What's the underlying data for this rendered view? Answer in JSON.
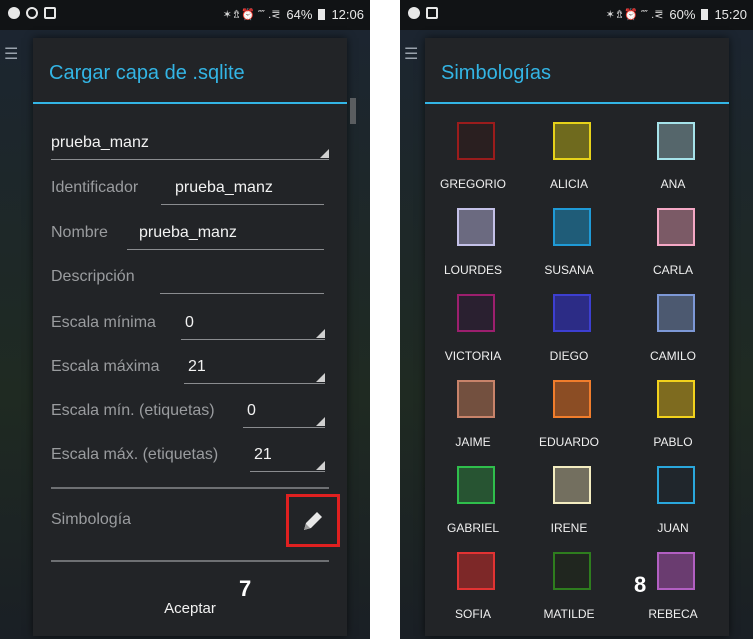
{
  "left_screen": {
    "status_bar": {
      "notification_icons": [
        "info-icon",
        "whatsapp-icon",
        "image-icon"
      ],
      "signal_text": "✶⇯⏰ ⁗ .⪙",
      "battery": "64%",
      "time": "12:06"
    },
    "dialog": {
      "title": "Cargar capa de .sqlite",
      "layer_select": "prueba_manz",
      "fields": [
        {
          "label": "Identificador",
          "value": "prueba_manz"
        },
        {
          "label": "Nombre",
          "value": "prueba_manz"
        },
        {
          "label": "Descripción",
          "value": ""
        }
      ],
      "scale_fields": [
        {
          "label": "Escala mínima",
          "value": "0"
        },
        {
          "label": "Escala máxima",
          "value": "21"
        },
        {
          "label": "Escala mín. (etiquetas)",
          "value": "0"
        },
        {
          "label": "Escala máx. (etiquetas)",
          "value": "21"
        }
      ],
      "symbology_label": "Simbología",
      "edit_icon": "pencil-icon",
      "accept_label": "Aceptar",
      "highlight_color": "#e02020"
    },
    "step_number": "7"
  },
  "right_screen": {
    "status_bar": {
      "notification_icons": [
        "info-icon",
        "image-icon"
      ],
      "signal_text": "✶⇯⏰ ⁗ .⪙",
      "battery": "60%",
      "time": "15:20"
    },
    "dialog": {
      "title": "Simbologías",
      "symbologies": [
        {
          "name": "GREGORIO",
          "border": "#9b1c1c",
          "fill": "#2a1f20"
        },
        {
          "name": "ALICIA",
          "border": "#e6d21a",
          "fill": "#6f6a1e"
        },
        {
          "name": "ANA",
          "border": "#a6e3ea",
          "fill": "#55666b"
        },
        {
          "name": "LOURDES",
          "border": "#c4c1e8",
          "fill": "#6b6a80"
        },
        {
          "name": "SUSANA",
          "border": "#1f9ad6",
          "fill": "#1f5c78"
        },
        {
          "name": "CARLA",
          "border": "#f5a8c5",
          "fill": "#7b5a66"
        },
        {
          "name": "VICTORIA",
          "border": "#9c1f6e",
          "fill": "#2a2030"
        },
        {
          "name": "DIEGO",
          "border": "#3d3fd1",
          "fill": "#2c2c86"
        },
        {
          "name": "CAMILO",
          "border": "#7d98d6",
          "fill": "#4c5970"
        },
        {
          "name": "JAIME",
          "border": "#c8836a",
          "fill": "#73503f"
        },
        {
          "name": "EDUARDO",
          "border": "#f07d2c",
          "fill": "#8b4d24"
        },
        {
          "name": "PABLO",
          "border": "#f2d21c",
          "fill": "#7e6b1f"
        },
        {
          "name": "GABRIEL",
          "border": "#2fbf4c",
          "fill": "#275432"
        },
        {
          "name": "IRENE",
          "border": "#f3ecc0",
          "fill": "#736f5f"
        },
        {
          "name": "JUAN",
          "border": "#2aa7dc",
          "fill": "#20262c"
        },
        {
          "name": "SOFIA",
          "border": "#e23333",
          "fill": "#7d2828"
        },
        {
          "name": "MATILDE",
          "border": "#2e7d1e",
          "fill": "#20261f"
        },
        {
          "name": "REBECA",
          "border": "#b25fc2",
          "fill": "#6a3c70"
        }
      ]
    },
    "step_number": "8"
  }
}
